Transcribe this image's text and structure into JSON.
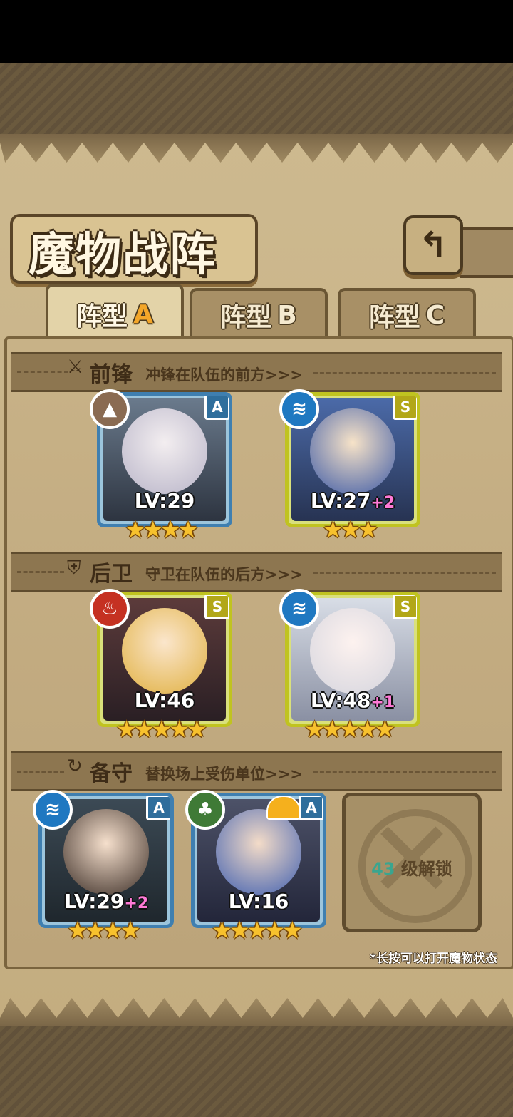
{
  "title": "魔物战阵",
  "back_icon": "back-arrow-icon",
  "tabs": [
    {
      "prefix": "阵型",
      "letter": "A",
      "active": true
    },
    {
      "prefix": "阵型",
      "letter": "B",
      "active": false
    },
    {
      "prefix": "阵型",
      "letter": "C",
      "active": false
    }
  ],
  "sections": {
    "front": {
      "title": "前锋",
      "desc": "冲锋在队伍的前方>>>",
      "icon": "sword-icon"
    },
    "rear": {
      "title": "后卫",
      "desc": "守卫在队伍的后方>>>",
      "icon": "shield-icon"
    },
    "reserve": {
      "title": "备守",
      "desc": "替换场上受伤单位>>>",
      "icon": "swap-icon"
    }
  },
  "cards": {
    "front1": {
      "rank": "A",
      "element": "rock",
      "level": "LV:29",
      "plus": "",
      "stars": "★★★★"
    },
    "front2": {
      "rank": "S",
      "element": "water",
      "level": "LV:27",
      "plus": "+2",
      "stars": "★★★"
    },
    "rear1": {
      "rank": "S",
      "element": "fire",
      "level": "LV:46",
      "plus": "",
      "stars": "★★★★★"
    },
    "rear2": {
      "rank": "S",
      "element": "water",
      "level": "LV:48",
      "plus": "+1",
      "stars": "★★★★★"
    },
    "res1": {
      "rank": "A",
      "element": "water",
      "level": "LV:29",
      "plus": "+2",
      "stars": "★★★★"
    },
    "res2": {
      "rank": "A",
      "element": "leaf",
      "level": "LV:16",
      "plus": "",
      "stars": "★★★★★"
    }
  },
  "locked_slot": {
    "level": "43",
    "text": "级解锁"
  },
  "footnote": "*长按可以打开魔物状态",
  "colors": {
    "water": "#1f78c1",
    "rock": "#8a6b52",
    "fire": "#c53122",
    "leaf": "#3f7a36",
    "rank_a": "#3f7fb0",
    "rank_s": "#c0c320"
  }
}
